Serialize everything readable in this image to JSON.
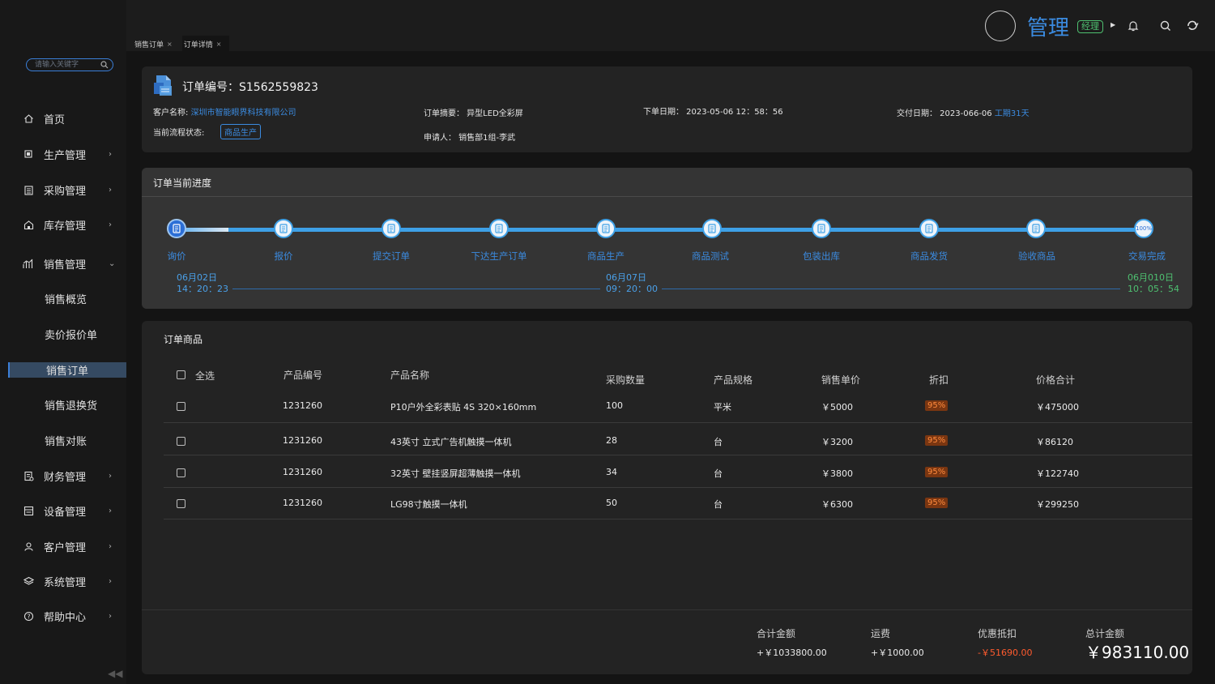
{
  "sidebar": {
    "search_placeholder": "请输入关键字",
    "items": [
      {
        "label": "首页",
        "icon": "home-icon"
      },
      {
        "label": "生产管理",
        "icon": "factory-icon"
      },
      {
        "label": "采购管理",
        "icon": "clipboard-icon"
      },
      {
        "label": "库存管理",
        "icon": "warehouse-icon"
      },
      {
        "label": "销售管理",
        "icon": "chart-icon"
      },
      {
        "label": "财务管理",
        "icon": "finance-icon"
      },
      {
        "label": "设备管理",
        "icon": "device-icon"
      },
      {
        "label": "客户管理",
        "icon": "customer-icon"
      },
      {
        "label": "系统管理",
        "icon": "layers-icon"
      },
      {
        "label": "帮助中心",
        "icon": "help-icon"
      }
    ],
    "sales_sub": [
      "销售概览",
      "卖价报价单",
      "销售订单",
      "销售退换货",
      "销售对账"
    ]
  },
  "tabs": [
    {
      "label": "销售订单"
    },
    {
      "label": "订单详情"
    }
  ],
  "header": {
    "brand": "管理",
    "role": "经理"
  },
  "order": {
    "title": "订单编号：S1562559823",
    "customer_label": "客户名称:",
    "customer": "深圳市智能眼界科技有限公司",
    "flow_label": "当前流程状态:",
    "flow_status": "商品生产",
    "summary": "订单摘要：  异型LED全彩屏",
    "applicant": "申请人：  销售部1组-李武",
    "order_date": "下单日期：  2023-05-06 12：58：56",
    "delivery_label": "交付日期：  2023-066-06",
    "delivery_period": "工期31天"
  },
  "progress": {
    "title": "订单当前进度",
    "steps": [
      "询价",
      "报价",
      "提交订单",
      "下达生产订单",
      "商品生产",
      "商品测试",
      "包装出库",
      "商品发货",
      "验收商品",
      "交易完成"
    ],
    "done_steps": 1,
    "final_badge": "100%",
    "stamps": [
      {
        "date": "06月02日",
        "time": "14：20：23"
      },
      {
        "date": "06月07日",
        "time": "09：20：00"
      },
      {
        "date": "06月010日",
        "time": "10：05：54"
      }
    ],
    "accent": "#3ea0e6",
    "done_color": "#4ec070"
  },
  "goods": {
    "title": "订单商品",
    "headers": [
      "全选",
      "产品编号",
      "产品名称",
      "采购数量",
      "产品规格",
      "销售单价",
      "折扣",
      "价格合计"
    ],
    "rows": [
      {
        "code": "1231260",
        "name": "P10户外全彩表贴 4S 320×160mm",
        "qty": "100",
        "unit": "平米",
        "price": "￥5000",
        "discount": "95%",
        "total": "￥475000"
      },
      {
        "code": "1231260",
        "name": "43英寸 立式广告机触摸一体机",
        "qty": "28",
        "unit": "台",
        "price": "￥3200",
        "discount": "95%",
        "total": "￥86120"
      },
      {
        "code": "1231260",
        "name": "32英寸 壁挂竖屏超薄触摸一体机",
        "qty": "34",
        "unit": "台",
        "price": "￥3800",
        "discount": "95%",
        "total": "￥122740"
      },
      {
        "code": "1231260",
        "name": "LG98寸触摸一体机",
        "qty": "50",
        "unit": "台",
        "price": "￥6300",
        "discount": "95%",
        "total": "￥299250"
      }
    ]
  },
  "summary": {
    "subtotal_label": "合计金额",
    "subtotal": "+￥1033800.00",
    "shipping_label": "运费",
    "shipping": "+￥1000.00",
    "discount_label": "优惠抵扣",
    "discount": "-￥51690.00",
    "total_label": "总计金额",
    "total": "￥983110.00"
  }
}
